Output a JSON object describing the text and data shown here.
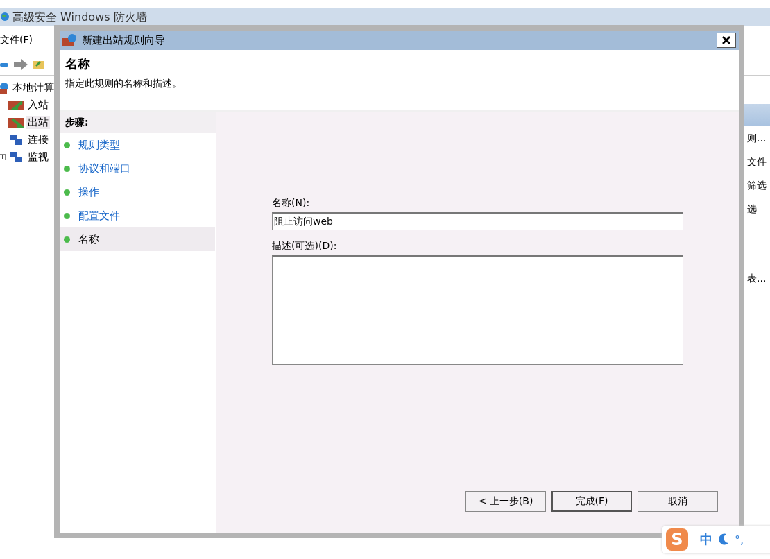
{
  "main_window": {
    "title": "高级安全 Windows 防火墙",
    "menu": [
      "文件(F)"
    ],
    "tree": [
      {
        "label": "本地计算",
        "children": [
          {
            "label": "入站",
            "kind": "inbound",
            "selected": false
          },
          {
            "label": "出站",
            "kind": "outbound",
            "selected": true
          },
          {
            "label": "连接",
            "kind": "connection",
            "selected": false
          },
          {
            "label": "监视",
            "kind": "monitor",
            "selected": false,
            "expanded": false
          }
        ]
      }
    ],
    "actions": [
      "则...",
      "文件",
      "筛选",
      "选",
      "表..."
    ]
  },
  "dialog": {
    "title": "新建出站规则向导",
    "heading": "名称",
    "subtitle": "指定此规则的名称和描述。",
    "steps_title": "步骤:",
    "steps": [
      {
        "label": "规则类型",
        "selected": false
      },
      {
        "label": "协议和端口",
        "selected": false
      },
      {
        "label": "操作",
        "selected": false
      },
      {
        "label": "配置文件",
        "selected": false
      },
      {
        "label": "名称",
        "selected": true
      }
    ],
    "name_label": "名称(N):",
    "name_value": "阻止访问web",
    "description_label": "描述(可选)(D):",
    "buttons": [
      {
        "label": "< 上一步(B)",
        "default": false
      },
      {
        "label": "完成(F)",
        "default": true
      },
      {
        "label": "取消",
        "default": false
      }
    ]
  },
  "ime_bar": {
    "logo": "S",
    "mode": "中",
    "punctuation": "°,"
  }
}
